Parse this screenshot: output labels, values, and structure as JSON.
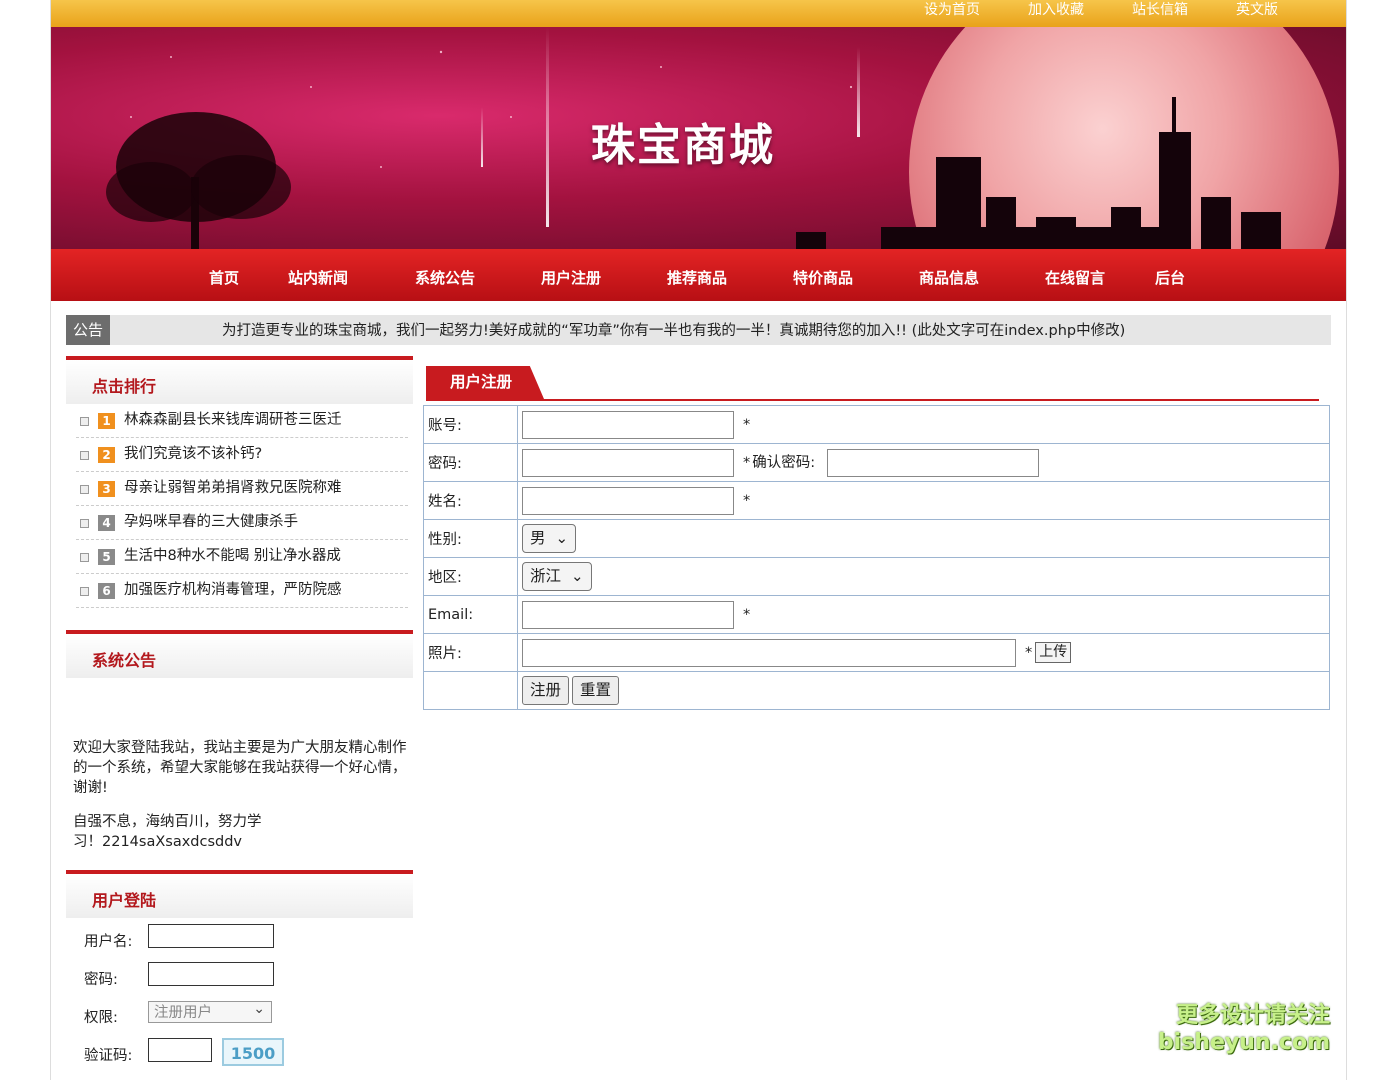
{
  "topbar": {
    "links": [
      "设为首页",
      "加入收藏",
      "站长信箱",
      "英文版"
    ]
  },
  "banner": {
    "title": "珠宝商城"
  },
  "nav": {
    "items": [
      "首页",
      "站内新闻",
      "系统公告",
      "用户注册",
      "推荐商品",
      "特价商品",
      "商品信息",
      "在线留言",
      "后台"
    ]
  },
  "notice": {
    "tag": "公告",
    "text": "为打造更专业的珠宝商城，我们一起努力!美好成就的“军功章”你有一半也有我的一半！真诚期待您的加入!! (此处文字可在index.php中修改)"
  },
  "ranking": {
    "title": "点击排行",
    "items": [
      {
        "num": "1",
        "label": "林森森副县长来钱库调研苍三医迁"
      },
      {
        "num": "2",
        "label": "我们究竟该不该补钙?"
      },
      {
        "num": "3",
        "label": "母亲让弱智弟弟捐肾救兄医院称难"
      },
      {
        "num": "4",
        "label": "孕妈咪早春的三大健康杀手"
      },
      {
        "num": "5",
        "label": "生活中8种水不能喝 别让净水器成"
      },
      {
        "num": "6",
        "label": "加强医疗机构消毒管理，严防院感"
      }
    ],
    "num_colors": [
      "#f0901e",
      "#f0901e",
      "#f0901e",
      "#8a8a8a",
      "#8a8a8a",
      "#8a8a8a"
    ]
  },
  "announcement": {
    "title": "系统公告",
    "p1": "欢迎大家登陆我站，我站主要是为广大朋友精心制作的一个系统，希望大家能够在我站获得一个好心情，谢谢!",
    "p2": "自强不息，海纳百川，努力学习！2214saXsaxdcsddv"
  },
  "login": {
    "title": "用户登陆",
    "username_label": "用户名:",
    "password_label": "密码:",
    "role_label": "权限:",
    "role_value": "注册用户",
    "captcha_label": "验证码:",
    "captcha_value": "1500"
  },
  "register": {
    "tab": "用户注册",
    "account_label": "账号:",
    "password_label": "密码:",
    "confirm_label": "确认密码:",
    "name_label": "姓名:",
    "gender_label": "性别:",
    "gender_value": "男",
    "region_label": "地区:",
    "region_value": "浙江",
    "email_label": "Email:",
    "photo_label": "照片:",
    "required_mark": "*",
    "upload_label": "上传",
    "submit_label": "注册",
    "reset_label": "重置"
  },
  "watermark": {
    "line1": "更多设计请关注",
    "line2": "bisheyun.com"
  }
}
